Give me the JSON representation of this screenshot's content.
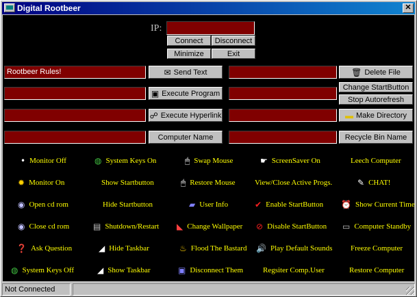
{
  "window": {
    "title": "Digital Rootbeer",
    "close_glyph": "✕"
  },
  "ip": {
    "label": "IP:",
    "value": ""
  },
  "top_buttons": {
    "connect": "Connect",
    "disconnect": "Disconnect",
    "minimize": "Minimize",
    "exit": "Exit"
  },
  "left_fields": {
    "text": "Rootbeer Rules!",
    "program": "",
    "hyperlink": "",
    "computer_name": ""
  },
  "right_fields": {
    "delete_file": "",
    "middle": "",
    "make_directory": "",
    "recycle": ""
  },
  "buttons": {
    "send_text": "Send Text",
    "execute_program": "Execute Program",
    "execute_hyperlink": "Execute Hyperlink",
    "computer_name": "Computer Name",
    "delete_file": "Delete File",
    "change_startbutton": "Change StartButton",
    "stop_autorefresh": "Stop Autorefresh",
    "make_directory": "Make Directory",
    "recycle_bin_name": "Recycle Bin Name"
  },
  "commands": [
    [
      "Monitor Off",
      "System Keys On",
      "Swap Mouse",
      "ScreenSaver On",
      "Leech Computer"
    ],
    [
      "Monitor On",
      "Show Startbutton",
      "Restore Mouse",
      "View/Close Active Progs.",
      "CHAT!"
    ],
    [
      "Open cd rom",
      "Hide Startbutton",
      "User Info",
      "Enable StartButton",
      "Show Current Time"
    ],
    [
      "Close cd rom",
      "Shutdown/Restart",
      "Change Wallpaper",
      "Disable StartButton",
      "Computer Standby"
    ],
    [
      "Ask Question",
      "Hide Taskbar",
      "Flood The Bastard",
      "Play Default Sounds",
      "Freeze Computer"
    ],
    [
      "System Keys Off",
      "Show Taskbar",
      "Disconnect Them",
      "Regsiter Comp.User",
      "Restore Computer"
    ]
  ],
  "status": {
    "text": "Not Connected"
  },
  "colors": {
    "field_bg": "#800000",
    "command_text": "#ffff00",
    "client_bg": "#000000",
    "title_start": "#000080"
  }
}
